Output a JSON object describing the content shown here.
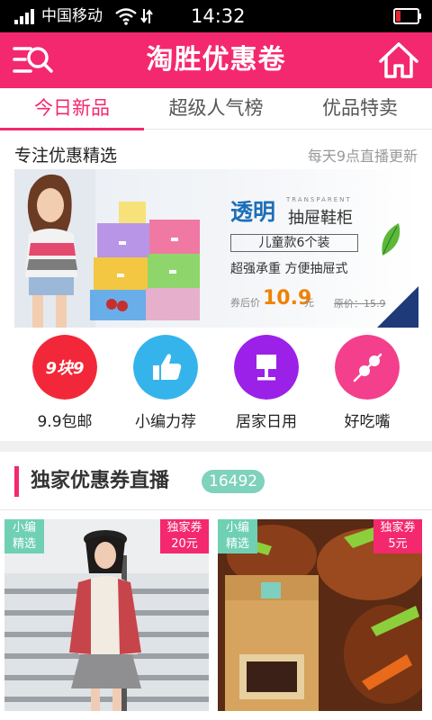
{
  "status_bar": {
    "carrier": "中国移动",
    "time": "14:32",
    "icons": [
      "signal-icon",
      "wifi-icon",
      "mobile-data-icon",
      "battery-icon"
    ]
  },
  "header": {
    "title": "淘胜优惠卷",
    "left_icon": "menu-search-icon",
    "right_icon": "home-icon",
    "color": "#f4286e"
  },
  "tabs": [
    {
      "label": "今日新品",
      "active": true
    },
    {
      "label": "超级人气榜",
      "active": false
    },
    {
      "label": "优品特卖",
      "active": false
    }
  ],
  "featured": {
    "title": "专注优惠精选",
    "subtitle": "每天9点直播更新",
    "banner": {
      "title_big": "透明",
      "title_en": "TRANSPARENT",
      "title_main": "抽屉鞋柜",
      "tag": "儿童款6个装",
      "desc": "超强承重 方便抽屉式",
      "price_label": "券后价",
      "price": "10.9",
      "price_unit": "元",
      "original_price": "原价：15.9"
    }
  },
  "categories": [
    {
      "label": "9.9包邮",
      "icon": "nine-nine-icon",
      "icon_text": "9块9",
      "color": "#f2283a"
    },
    {
      "label": "小编力荐",
      "icon": "thumbs-up-icon",
      "color": "#35b4ec"
    },
    {
      "label": "居家日用",
      "icon": "lamp-icon",
      "color": "#9b21e8"
    },
    {
      "label": "好吃嘴",
      "icon": "skewer-icon",
      "color": "#f43f8d"
    }
  ],
  "live": {
    "title": "独家优惠券直播",
    "count": "16492"
  },
  "products": [
    {
      "tag_left": [
        "小编",
        "精选"
      ],
      "tag_right": [
        "独家券",
        "20元"
      ],
      "image": "model-in-sweater"
    },
    {
      "tag_left": [
        "小编",
        "精选"
      ],
      "tag_right": [
        "独家券",
        "5元"
      ],
      "image": "braised-meat-package"
    }
  ]
}
